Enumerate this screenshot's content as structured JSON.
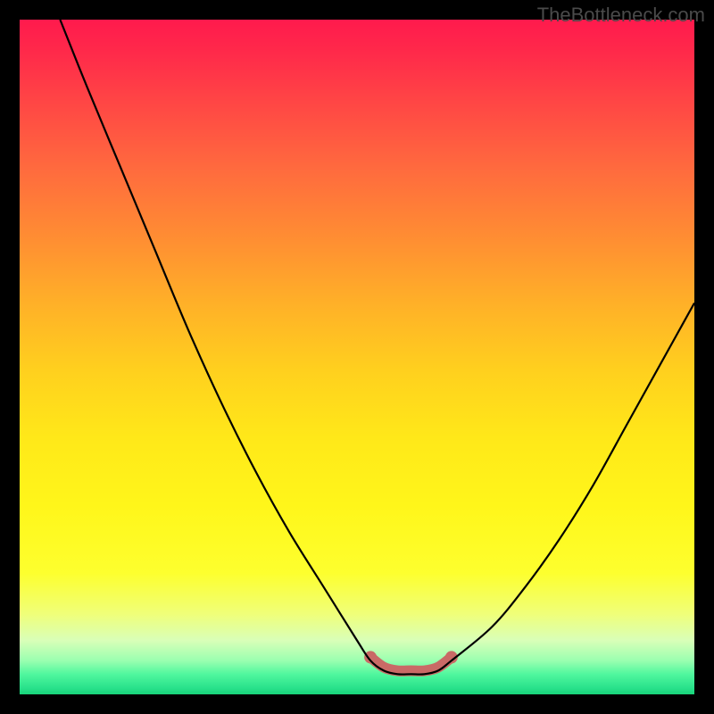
{
  "watermark": "TheBottleneck.com",
  "chart_data": {
    "type": "line",
    "title": "",
    "xlabel": "",
    "ylabel": "",
    "xlim": [
      0,
      100
    ],
    "ylim": [
      0,
      100
    ],
    "series": [
      {
        "name": "bottleneck-curve",
        "x": [
          6,
          10,
          15,
          20,
          25,
          30,
          35,
          40,
          45,
          50,
          52,
          54,
          56,
          58,
          60,
          62,
          64,
          70,
          75,
          80,
          85,
          90,
          95,
          100
        ],
        "y": [
          100,
          90,
          78,
          66,
          54,
          43,
          33,
          24,
          16,
          8,
          5,
          3.5,
          3,
          3,
          3,
          3.5,
          5,
          10,
          16,
          23,
          31,
          40,
          49,
          58
        ]
      },
      {
        "name": "optimal-band",
        "x": [
          52,
          54,
          56,
          58,
          60,
          62,
          64
        ],
        "y": [
          5.5,
          4,
          3.5,
          3.5,
          3.5,
          4,
          5.5
        ]
      }
    ]
  },
  "colors": {
    "curve": "#000000",
    "band": "#c96a66",
    "gradient_top": "#ff1a4d",
    "gradient_bottom": "#18d47a"
  }
}
